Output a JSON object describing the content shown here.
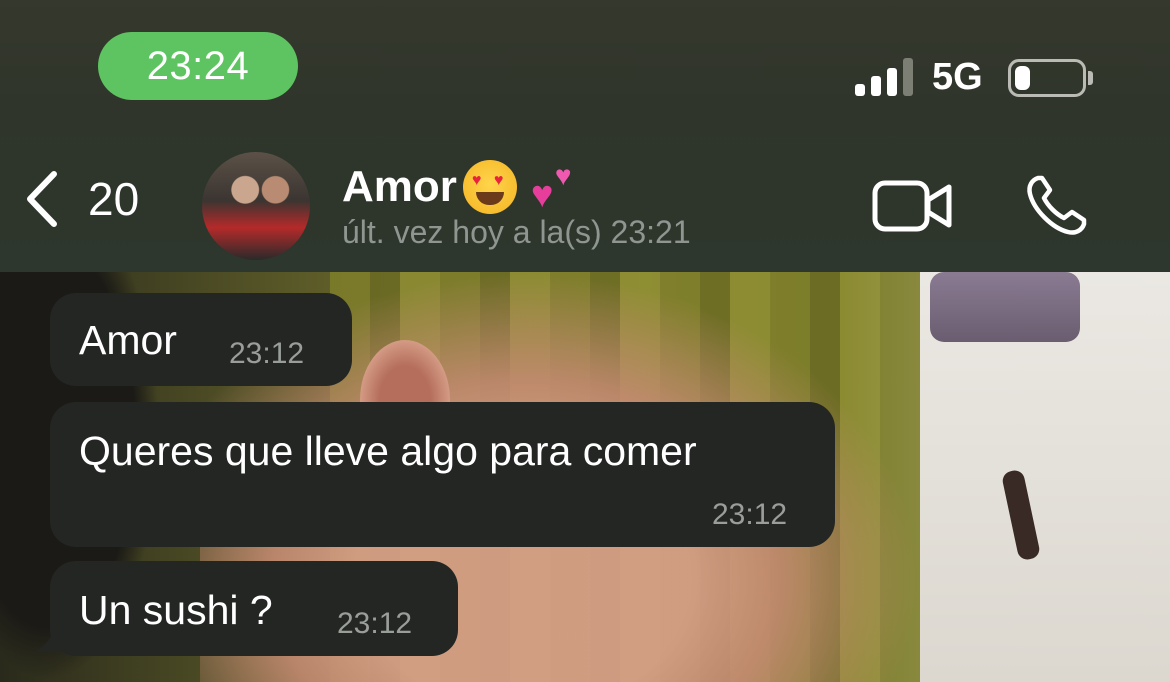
{
  "status_bar": {
    "time": "23:24",
    "network": "5G",
    "signal_bars_active": 3,
    "signal_bars_total": 4,
    "battery_level": 0.22
  },
  "header": {
    "back_count": "20",
    "contact_name": "Amor",
    "contact_emojis": [
      "smiling-face-with-heart-eyes",
      "two-hearts"
    ],
    "last_seen": "últ. vez hoy a la(s) 23:21",
    "icons": [
      "chevron-left-icon",
      "video-call-icon",
      "phone-call-icon"
    ]
  },
  "messages": [
    {
      "text": "Amor",
      "time": "23:12",
      "direction": "incoming"
    },
    {
      "text": "Queres que lleve algo para comer",
      "time": "23:12",
      "direction": "incoming"
    },
    {
      "text": "Un sushi ?",
      "time": "23:12",
      "direction": "incoming"
    }
  ],
  "colors": {
    "time_pill": "#5ec461",
    "bubble": "#242624",
    "header": "#2f352b"
  }
}
